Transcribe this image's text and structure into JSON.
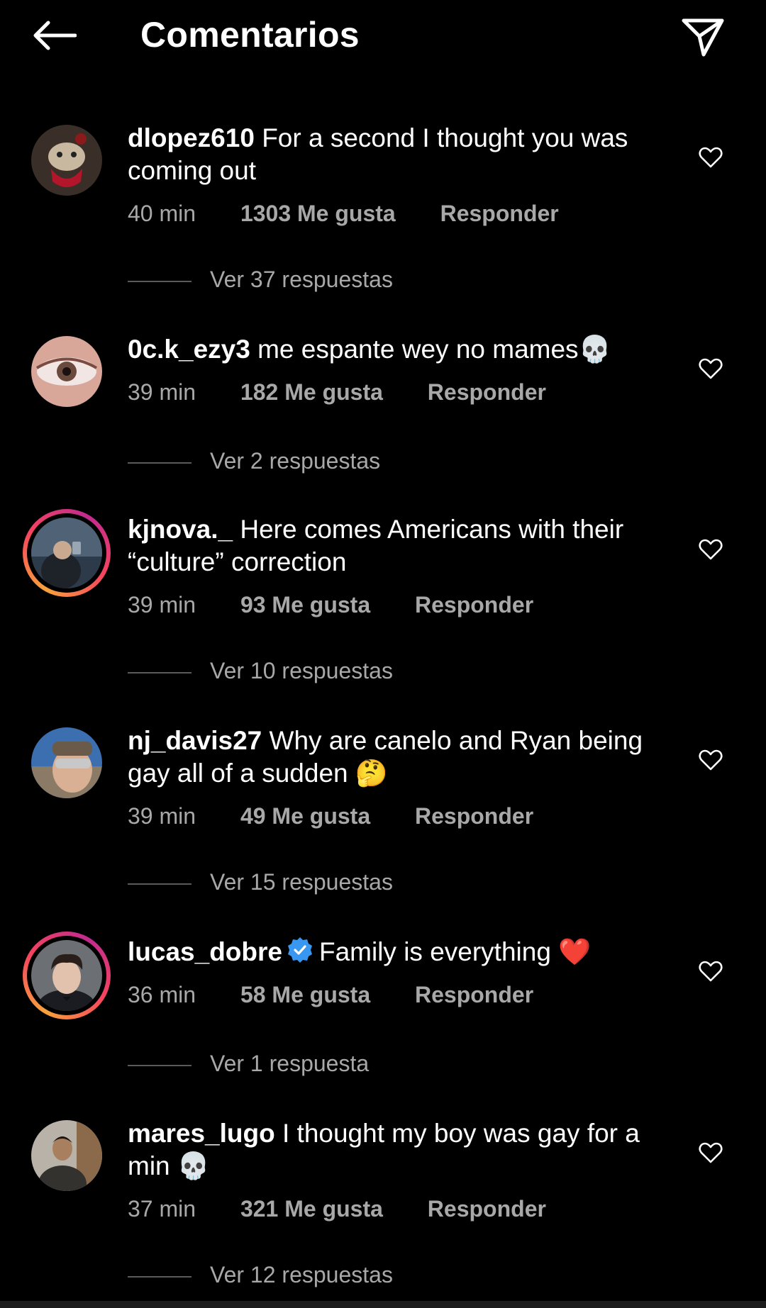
{
  "header": {
    "title": "Comentarios",
    "back_icon": "arrow-left-icon",
    "share_icon": "paper-plane-icon"
  },
  "colors": {
    "background": "#000000",
    "text": "#ffffff",
    "meta": "#a8a8a8",
    "verified": "#3897f0",
    "story_ring": [
      "#f9a23b",
      "#f5445f",
      "#c22a8f"
    ]
  },
  "comments": [
    {
      "username": "dlopez610",
      "text": "For a second I thought you was coming out",
      "time": "40 min",
      "likes": "1303 Me gusta",
      "reply": "Responder",
      "replies": "Ver 37 respuestas",
      "story_ring": false,
      "verified": false
    },
    {
      "username": "0c.k_ezy3",
      "text": "me espante wey no mames💀",
      "time": "39 min",
      "likes": "182 Me gusta",
      "reply": "Responder",
      "replies": "Ver 2 respuestas",
      "story_ring": false,
      "verified": false
    },
    {
      "username": "kjnova._",
      "text": "Here comes Americans with their “culture” correction",
      "time": "39 min",
      "likes": "93 Me gusta",
      "reply": "Responder",
      "replies": "Ver 10 respuestas",
      "story_ring": true,
      "verified": false
    },
    {
      "username": "nj_davis27",
      "text": "Why are canelo and Ryan being gay all of a sudden 🤔",
      "time": "39 min",
      "likes": "49 Me gusta",
      "reply": "Responder",
      "replies": "Ver 15 respuestas",
      "story_ring": false,
      "verified": false
    },
    {
      "username": "lucas_dobre",
      "text": "Family is everything ❤️",
      "time": "36 min",
      "likes": "58 Me gusta",
      "reply": "Responder",
      "replies": "Ver 1 respuesta",
      "story_ring": true,
      "verified": true
    },
    {
      "username": "mares_lugo",
      "text": "I thought my boy was gay for a min 💀",
      "time": "37 min",
      "likes": "321 Me gusta",
      "reply": "Responder",
      "replies": "Ver 12 respuestas",
      "story_ring": false,
      "verified": false
    }
  ]
}
